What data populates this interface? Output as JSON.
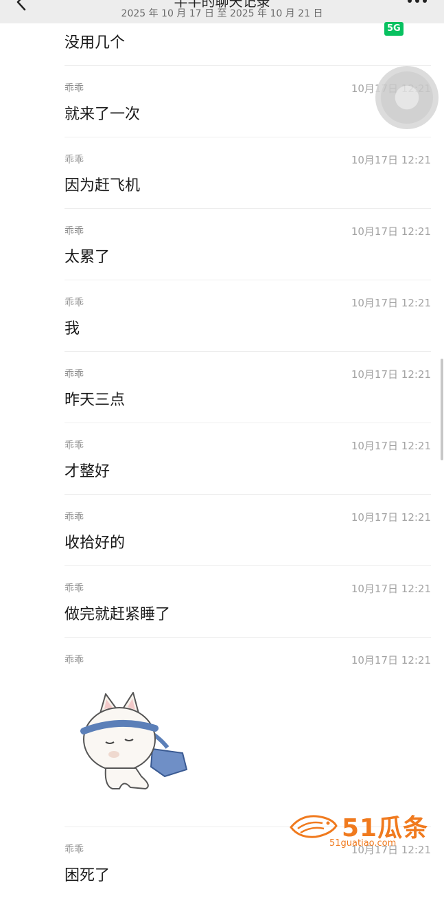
{
  "header": {
    "title": "半半的聊天记录",
    "date_range": "2025 年 10 月 17 日 至 2025 年 10 月 21 日",
    "back_icon": "chevron-left-icon",
    "more_icon": "more-dots-icon",
    "badge": "5G"
  },
  "first_message": {
    "text": "没用几个"
  },
  "messages": [
    {
      "sender": "乖乖",
      "time": "10月17日 12:21",
      "text": "就来了一次"
    },
    {
      "sender": "乖乖",
      "time": "10月17日 12:21",
      "text": "因为赶飞机"
    },
    {
      "sender": "乖乖",
      "time": "10月17日 12:21",
      "text": "太累了"
    },
    {
      "sender": "乖乖",
      "time": "10月17日 12:21",
      "text": "我"
    },
    {
      "sender": "乖乖",
      "time": "10月17日 12:21",
      "text": "昨天三点"
    },
    {
      "sender": "乖乖",
      "time": "10月17日 12:21",
      "text": "才整好"
    },
    {
      "sender": "乖乖",
      "time": "10月17日 12:21",
      "text": "收拾好的"
    },
    {
      "sender": "乖乖",
      "time": "10月17日 12:21",
      "text": "做完就赶紧睡了"
    },
    {
      "sender": "乖乖",
      "time": "10月17日 12:21",
      "sticker": "sleepy-cat-sticker"
    },
    {
      "sender": "乖乖",
      "time": "10月17日 12:21",
      "text": "困死了"
    }
  ],
  "watermark": {
    "brand": "51瓜条",
    "url": "51guatiao.com"
  },
  "colors": {
    "header_bg": "#ededed",
    "badge_green": "#07c160",
    "watermark_orange": "#f07a1e",
    "meta_gray": "#a3a3a3"
  }
}
